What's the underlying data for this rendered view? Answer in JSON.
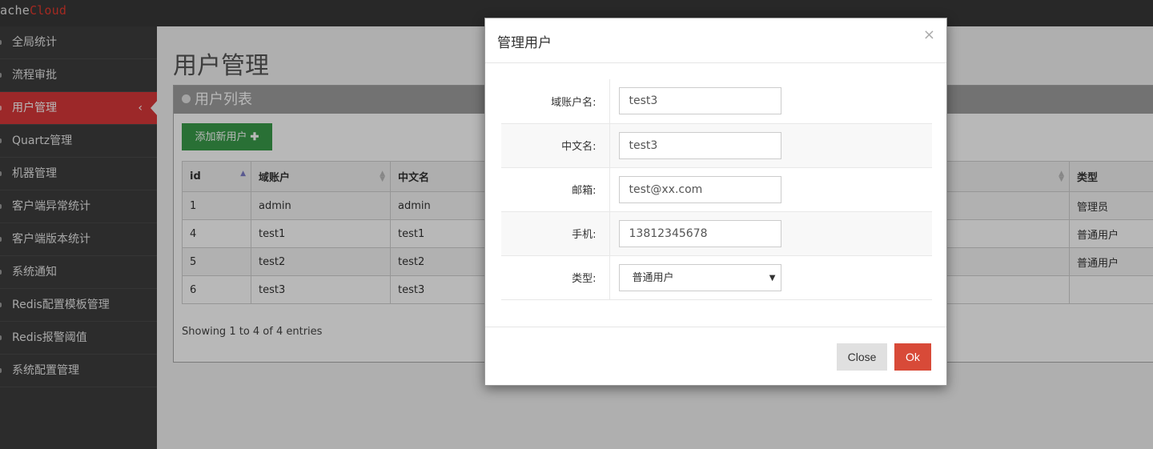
{
  "app": {
    "logo_part1": "ache",
    "logo_part2": "Cloud"
  },
  "sidebar": {
    "items": [
      {
        "label": "全局统计"
      },
      {
        "label": "流程审批"
      },
      {
        "label": "用户管理"
      },
      {
        "label": "Quartz管理"
      },
      {
        "label": "机器管理"
      },
      {
        "label": "客户端异常统计"
      },
      {
        "label": "客户端版本统计"
      },
      {
        "label": "系统通知"
      },
      {
        "label": "Redis配置模板管理"
      },
      {
        "label": "Redis报警阈值"
      },
      {
        "label": "系统配置管理"
      }
    ],
    "active_index": 2,
    "collapse_icon": "chevron-left-icon"
  },
  "main": {
    "page_title": "用户管理",
    "portlet_title": "用户列表",
    "add_button": {
      "label": "添加新用户",
      "icon": "plus-icon"
    },
    "table": {
      "columns": [
        "id",
        "域账户",
        "中文名",
        "类型"
      ],
      "rows": [
        {
          "id": "1",
          "account": "admin",
          "name": "admin",
          "type": "管理员"
        },
        {
          "id": "4",
          "account": "test1",
          "name": "test1",
          "type": "普通用户"
        },
        {
          "id": "5",
          "account": "test2",
          "name": "test2",
          "type": "普通用户"
        },
        {
          "id": "6",
          "account": "test3",
          "name": "test3",
          "type": ""
        }
      ]
    },
    "showing_text": "Showing 1 to 4 of 4 entries"
  },
  "modal": {
    "title": "管理用户",
    "close_icon": "close-icon",
    "fields": {
      "account": {
        "label": "域账户名:",
        "value": "test3"
      },
      "name": {
        "label": "中文名:",
        "value": "test3"
      },
      "email": {
        "label": "邮箱:",
        "value": "test@xx.com"
      },
      "phone": {
        "label": "手机:",
        "value": "13812345678"
      },
      "type": {
        "label": "类型:",
        "value": "普通用户"
      }
    },
    "close_label": "Close",
    "ok_label": "Ok"
  },
  "colors": {
    "accent_red": "#d9383a",
    "add_green": "#3a9c4a",
    "ok_red": "#d84a38"
  }
}
